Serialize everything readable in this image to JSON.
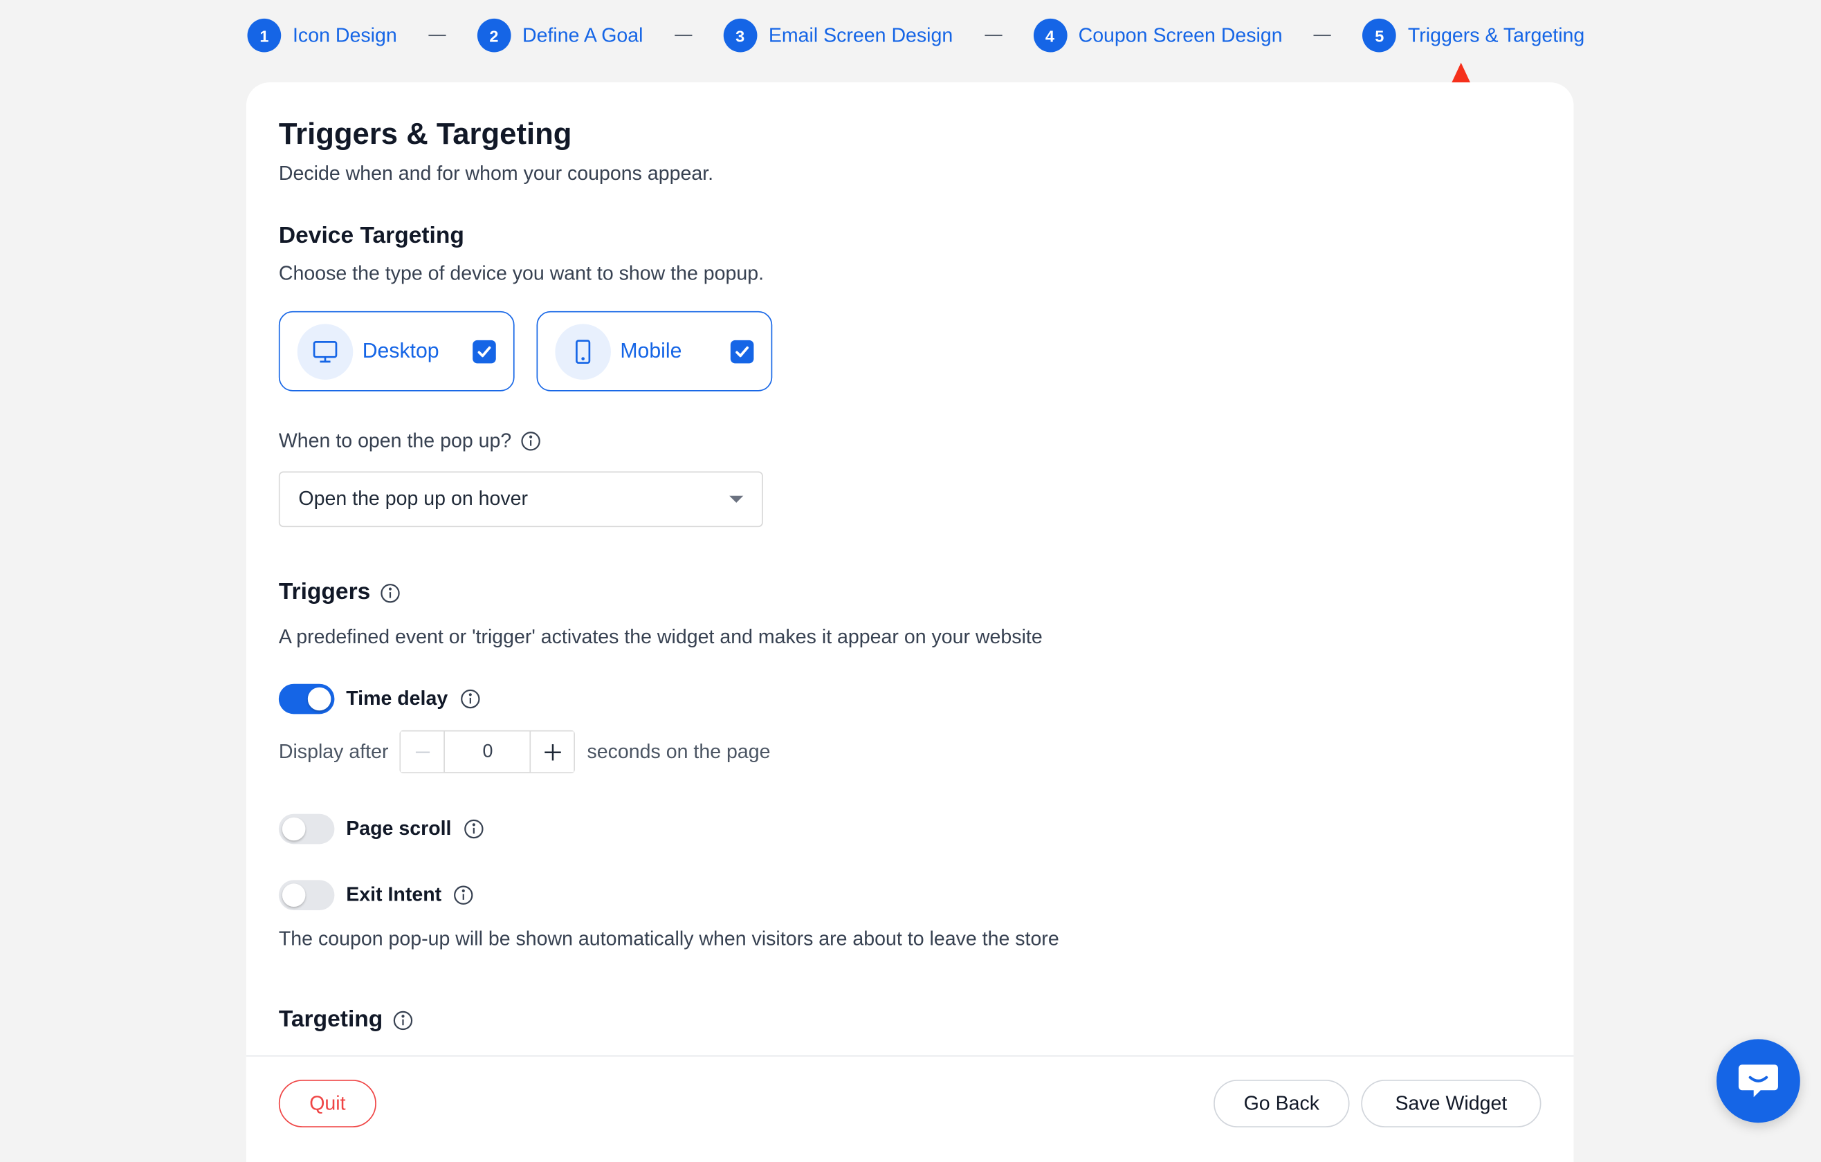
{
  "stepper": {
    "steps": [
      {
        "num": "1",
        "label": "Icon Design"
      },
      {
        "num": "2",
        "label": "Define A Goal"
      },
      {
        "num": "3",
        "label": "Email Screen Design"
      },
      {
        "num": "4",
        "label": "Coupon Screen Design"
      },
      {
        "num": "5",
        "label": "Triggers & Targeting"
      }
    ],
    "separator": "—"
  },
  "page": {
    "title": "Triggers & Targeting",
    "subtitle": "Decide when and for whom your coupons appear."
  },
  "device_targeting": {
    "heading": "Device Targeting",
    "description": "Choose the type of device you want to show the popup.",
    "options": [
      {
        "label": "Desktop",
        "icon": "desktop-icon",
        "checked": true
      },
      {
        "label": "Mobile",
        "icon": "mobile-icon",
        "checked": true
      }
    ]
  },
  "open_popup": {
    "label": "When to open the pop up?",
    "selected": "Open the pop up on hover"
  },
  "triggers": {
    "heading": "Triggers",
    "description": "A predefined event or 'trigger' activates the widget and makes it appear on your website",
    "time_delay": {
      "label": "Time delay",
      "enabled": true,
      "prefix": "Display after",
      "value": "0",
      "suffix": "seconds on the page"
    },
    "page_scroll": {
      "label": "Page scroll",
      "enabled": false
    },
    "exit_intent": {
      "label": "Exit Intent",
      "enabled": false,
      "description": "The coupon pop-up will be shown automatically when visitors are about to leave the store"
    }
  },
  "targeting": {
    "heading": "Targeting"
  },
  "footer": {
    "quit_label": "Quit",
    "back_label": "Go Back",
    "save_label": "Save Widget"
  },
  "colors": {
    "accent": "#1565e6",
    "danger": "#ef4444",
    "annotation_arrow": "#f5301b"
  }
}
